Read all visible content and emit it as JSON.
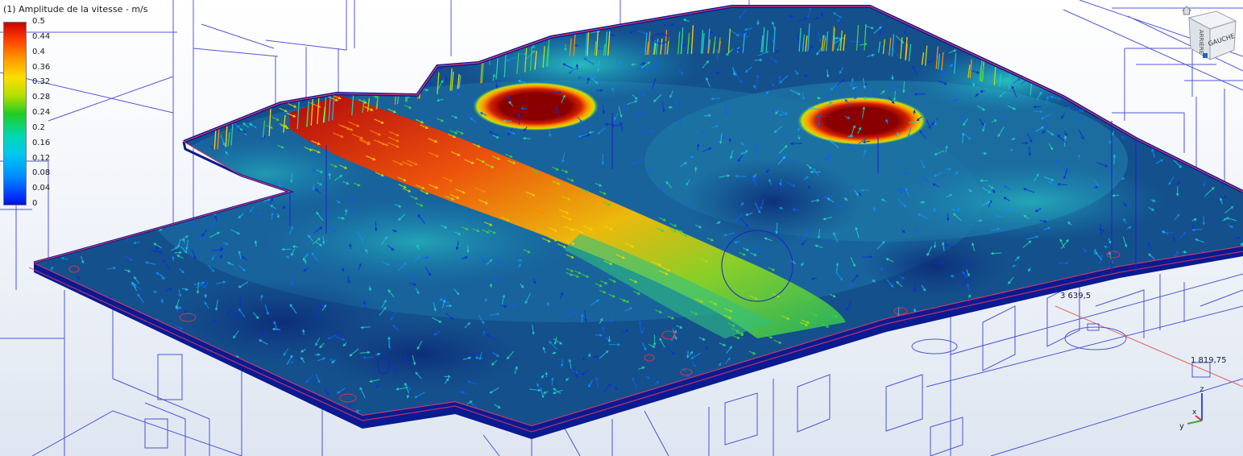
{
  "legend": {
    "title": "(1) Amplitude de la vitesse - m/s",
    "ticks": [
      "0.5",
      "0.44",
      "0.4",
      "0.36",
      "0.32",
      "0.28",
      "0.24",
      "0.2",
      "0.16",
      "0.12",
      "0.08",
      "0.04",
      "0"
    ],
    "range": [
      0,
      0.5
    ],
    "colormap": [
      "#0010e0",
      "#0040ff",
      "#0090ff",
      "#00c8ee",
      "#00d8b0",
      "#22cc22",
      "#b4e000",
      "#ffdd00",
      "#ff9900",
      "#ff4400",
      "#cc0000"
    ]
  },
  "viewcube": {
    "label_left": "ARRIÈRE",
    "label_front": "GAUCHE",
    "home_icon": "home-icon"
  },
  "dimensions": {
    "dim_a": "3 639,5",
    "dim_b": "1 819,75"
  },
  "axis_triad": {
    "x": "x",
    "y": "y",
    "z": "z",
    "colors": {
      "x": "#e53030",
      "y": "#30b030",
      "z": "#3050e0"
    }
  },
  "scene": {
    "background_top": "#ffffff",
    "background_bottom": "#dfe6f1",
    "wireframe_color": "#1a22cc",
    "slab_edge_color": "#e23a6a",
    "slab_fill_color": "#0a1a90"
  }
}
